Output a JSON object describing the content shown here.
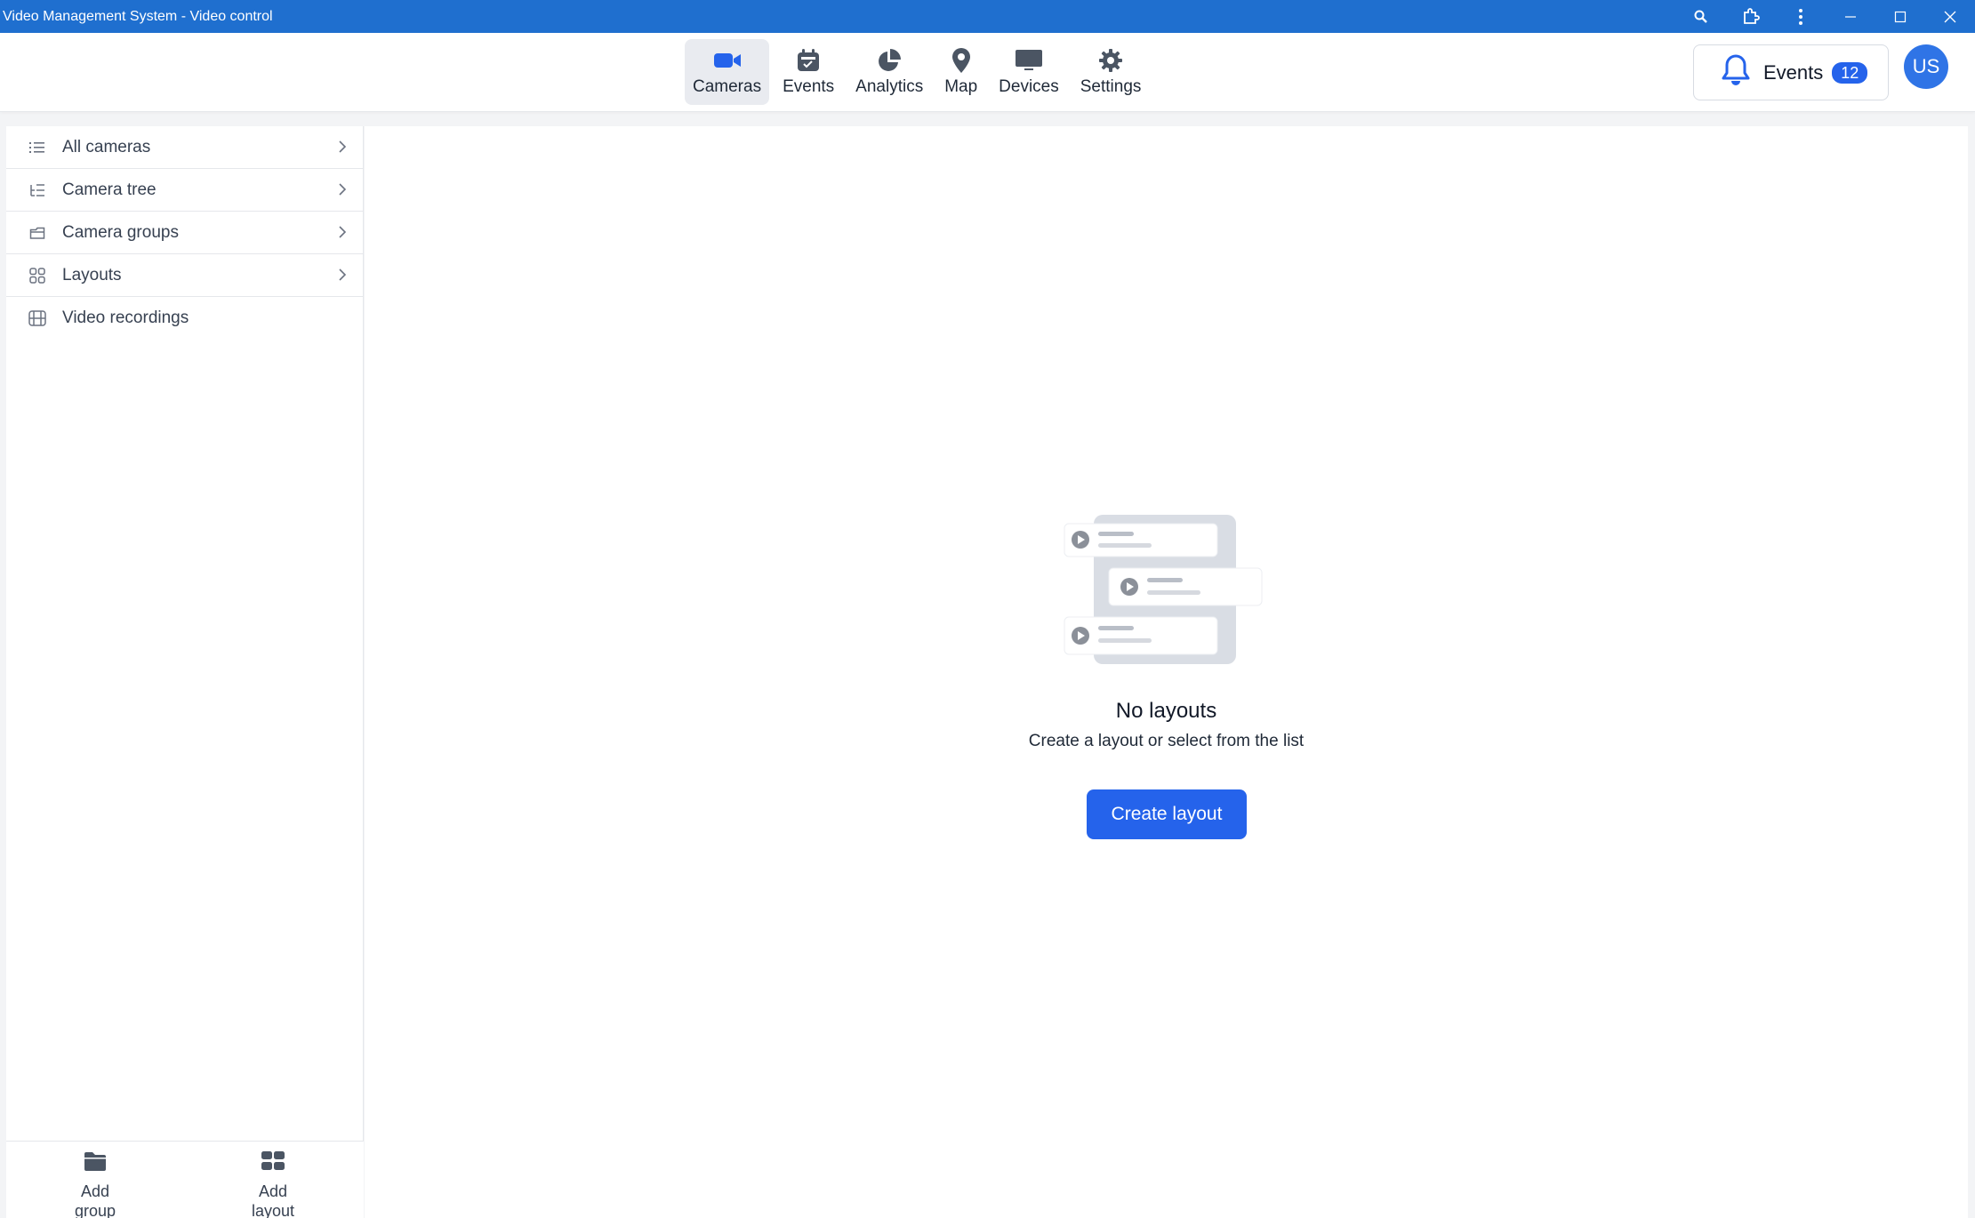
{
  "window": {
    "title": "Video Management System - Video control",
    "controls": [
      "search-icon",
      "extension-icon",
      "more-vertical-icon",
      "minimize-icon",
      "maximize-icon",
      "close-icon"
    ]
  },
  "nav": {
    "items": [
      {
        "label": "Cameras",
        "icon": "video-camera-icon",
        "active": true
      },
      {
        "label": "Events",
        "icon": "calendar-icon",
        "active": false
      },
      {
        "label": "Analytics",
        "icon": "pie-chart-icon",
        "active": false
      },
      {
        "label": "Map",
        "icon": "map-pin-icon",
        "active": false
      },
      {
        "label": "Devices",
        "icon": "monitor-icon",
        "active": false
      },
      {
        "label": "Settings",
        "icon": "gear-icon",
        "active": false
      }
    ],
    "events_label": "Events",
    "events_count": "12",
    "avatar_initials": "US"
  },
  "sidebar": {
    "items": [
      {
        "label": "All cameras",
        "icon": "list-icon",
        "has_arrow": true
      },
      {
        "label": "Camera tree",
        "icon": "tree-icon",
        "has_arrow": true
      },
      {
        "label": "Camera groups",
        "icon": "folder-icon",
        "has_arrow": true
      },
      {
        "label": "Layouts",
        "icon": "grid-icon",
        "has_arrow": true
      },
      {
        "label": "Video recordings",
        "icon": "film-icon",
        "has_arrow": false
      }
    ],
    "bottom": {
      "add_group": "Add group",
      "add_layout": "Add layout"
    }
  },
  "main": {
    "empty_title": "No layouts",
    "empty_subtitle": "Create a layout or select from the list",
    "create_button": "Create layout"
  },
  "colors": {
    "titlebar": "#1f6fcf",
    "accent": "#2563eb",
    "active_nav_bg": "#e9ebf0"
  }
}
